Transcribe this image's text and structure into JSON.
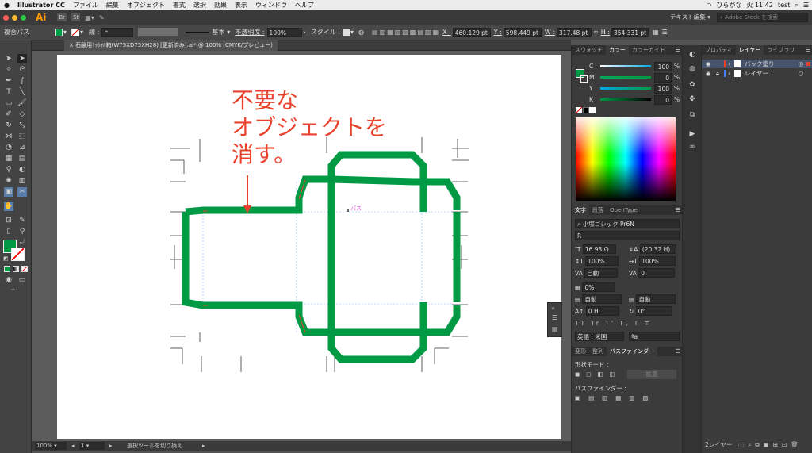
{
  "menubar": {
    "app_name": "Illustrator CC",
    "items": [
      "ファイル",
      "編集",
      "オブジェクト",
      "書式",
      "選択",
      "効果",
      "表示",
      "ウィンドウ",
      "ヘルプ"
    ],
    "ime": "ひらがな",
    "clock": "火 11:42",
    "user": "test"
  },
  "appbar": {
    "logo": "Ai",
    "br": "Br",
    "st": "St",
    "workspace": "テキスト編集",
    "stock_search_placeholder": "Adobe Stock を検索"
  },
  "control": {
    "selection_type": "複合パス",
    "stroke_label": "線 :",
    "brush": "基本",
    "opacity_label": "不透明度 :",
    "opacity": "100%",
    "style_label": "スタイル :",
    "x_label": "X :",
    "x": "460.129 pt",
    "y_label": "Y :",
    "y": "598.449 pt",
    "w_label": "W :",
    "w": "317.48 pt",
    "h_label": "H :",
    "h": "354.331 pt"
  },
  "document": {
    "tab_title": "石鹸用ｻｯｼｬﾙ箱(W75XD75XH28) [更新済み].ai* @ 100% (CMYK/プレビュー)"
  },
  "canvas": {
    "annotation_lines": [
      "不要な",
      "オブジェクトを",
      "消す。"
    ],
    "path_label": "パス"
  },
  "status": {
    "zoom": "100%",
    "artboard": "1",
    "message": "選択ツールを切り換え"
  },
  "color_panel": {
    "tabs": [
      "スウォッチ",
      "カラー",
      "カラーガイド"
    ],
    "active": "カラー",
    "channels": [
      {
        "label": "C",
        "value": "100"
      },
      {
        "label": "M",
        "value": "0"
      },
      {
        "label": "Y",
        "value": "100"
      },
      {
        "label": "K",
        "value": "0"
      }
    ],
    "unit": "%"
  },
  "char_panel": {
    "tabs": [
      "文字",
      "段落",
      "OpenType"
    ],
    "font": "小塚ゴシック Pr6N",
    "style": "R",
    "size": "16.93 Q",
    "leading": "(20.32 H)",
    "v_scale": "100%",
    "h_scale": "100%",
    "kerning": "自動",
    "tracking": "0",
    "tsume": "0%",
    "aki_left": "自動",
    "aki_right": "自動",
    "baseline": "0 H",
    "rotate": "0°",
    "lang": "英語 : 米国",
    "aa": "ªa"
  },
  "pathfinder": {
    "tabs": [
      "変形",
      "整列",
      "パスファインダー"
    ],
    "shape_modes_label": "形状モード :",
    "expand_label": "拡張",
    "pathfinders_label": "パスファインダー :"
  },
  "layers_panel": {
    "tabs": [
      "プロパティ",
      "レイヤー",
      "ライブラリ"
    ],
    "active": "レイヤー",
    "layers": [
      {
        "name": "バック塗り",
        "color": "#e8412c"
      },
      {
        "name": "レイヤー 1",
        "color": "#4a7cff"
      }
    ],
    "footer": "2レイヤー"
  },
  "colors": {
    "accent_green": "#009a44",
    "annotation_red": "#e8412c"
  }
}
